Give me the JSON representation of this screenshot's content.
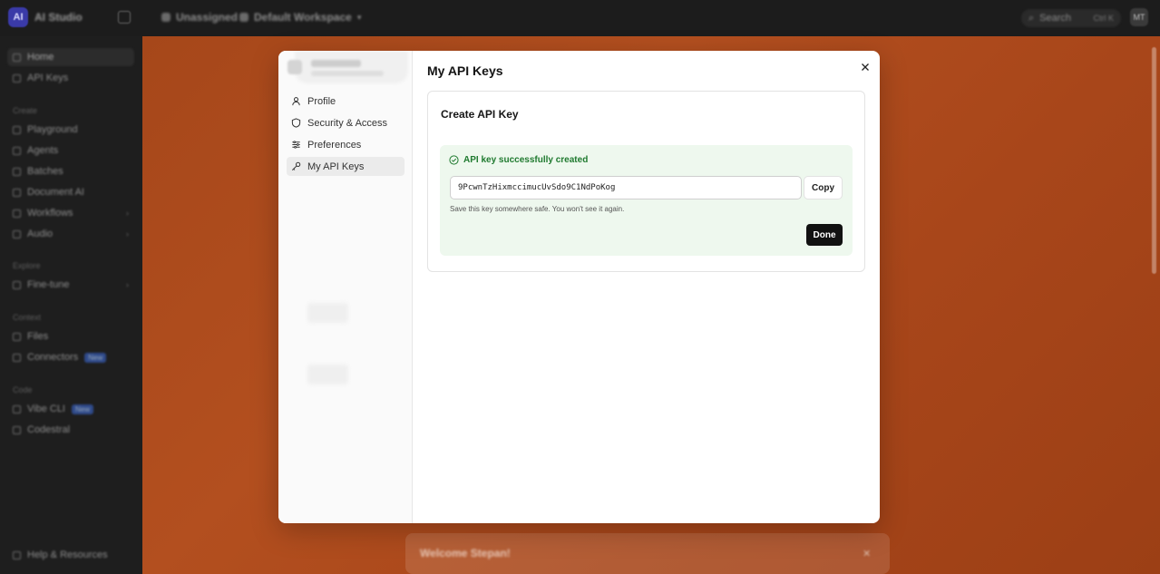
{
  "topbar": {
    "logo": "AI",
    "app_name": "AI Studio",
    "breadcrumbs": [
      "Unassigned",
      "Default Workspace"
    ],
    "search_label": "Search",
    "search_shortcut": "Ctrl K",
    "avatar": "MT"
  },
  "sidebar": {
    "top_items": [
      {
        "label": "Home",
        "active": true
      },
      {
        "label": "API Keys"
      }
    ],
    "sections": [
      {
        "title": "Create",
        "items": [
          "Playground",
          "Agents",
          "Batches",
          "Document AI",
          "Workflows",
          "Audio"
        ]
      },
      {
        "title": "Explore",
        "items": [
          "Fine-tune"
        ]
      },
      {
        "title": "Context",
        "items": [
          "Files",
          "Connectors"
        ]
      },
      {
        "title": "Code",
        "items": [
          "Vibe CLI",
          "Codestral"
        ]
      }
    ],
    "badges": {
      "connectors": "New",
      "vibe_cli": "New"
    },
    "help": "Help & Resources"
  },
  "background": {
    "welcome": "Welcome Stepan!",
    "welcome_close": "✕"
  },
  "modal": {
    "title": "My API Keys",
    "nav": [
      {
        "label": "Profile",
        "icon": "user-icon"
      },
      {
        "label": "Security & Access",
        "icon": "shield-icon"
      },
      {
        "label": "Preferences",
        "icon": "sliders-icon"
      },
      {
        "label": "My API Keys",
        "icon": "key-icon",
        "active": true
      }
    ],
    "card_title": "Create API Key",
    "success": {
      "title": "API key successfully created",
      "key_value": "9PcwnTzHixmccimucUvSdo9C1NdPoKog",
      "copy_label": "Copy",
      "hint": "Save this key somewhere safe. You won't see it again.",
      "done_label": "Done"
    }
  },
  "colors": {
    "accent_orange": "#b34f1f",
    "success_bg": "#eef8ee",
    "success_text": "#1f7a2f",
    "button_dark": "#111111"
  }
}
